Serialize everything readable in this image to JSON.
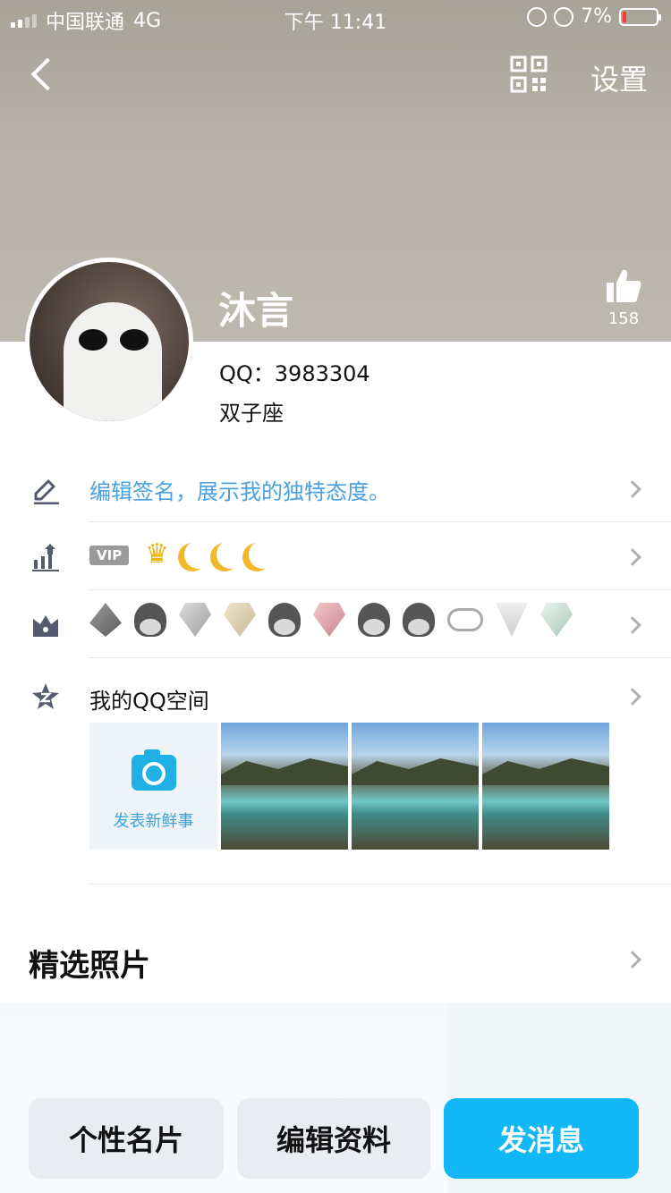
{
  "status_bar": {
    "carrier": "中国联通",
    "network": "4G",
    "time": "下午 11:41",
    "battery": "7%"
  },
  "nav": {
    "settings_label": "设置"
  },
  "profile": {
    "nickname": "沐言",
    "like_count": "158",
    "qq_number": "QQ：3983304",
    "zodiac": "双子座"
  },
  "rows": {
    "signature_placeholder": "编辑签名，展示我的独特态度。",
    "vip_label": "VIP",
    "space_title": "我的QQ空间",
    "post_label": "发表新鲜事"
  },
  "featured": {
    "title": "精选照片"
  },
  "actions": {
    "card": "个性名片",
    "edit": "编辑资料",
    "message": "发消息"
  },
  "colors": {
    "accent": "#12b7f5",
    "link": "#4aa0e0"
  }
}
